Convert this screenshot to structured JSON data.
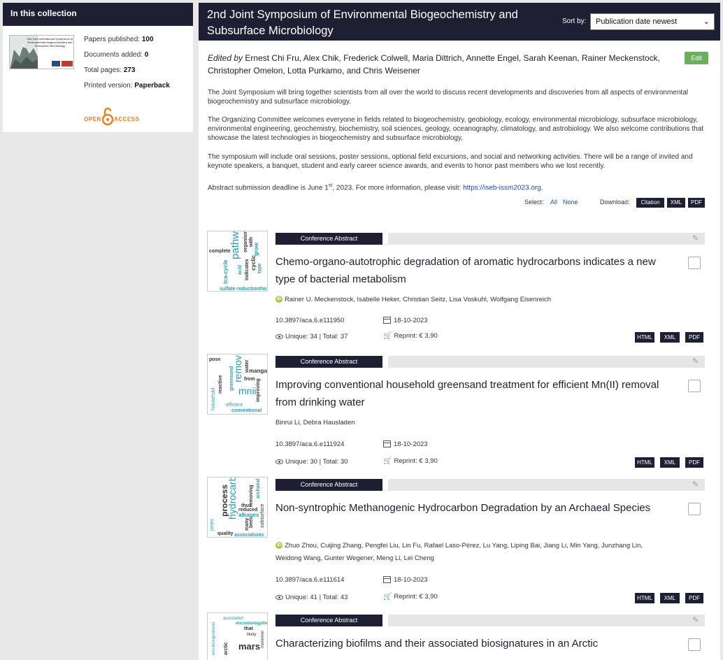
{
  "sidebar": {
    "heading": "In this collection",
    "cover_title": "2nd Joint International Symposium of Environmental Biogeochemistry and Subsurface Microbiology",
    "stats": [
      {
        "label": "Papers published:",
        "value": "100"
      },
      {
        "label": "Documents added:",
        "value": "0"
      },
      {
        "label": "Total pages:",
        "value": "273"
      },
      {
        "label": "Printed version:",
        "value": "Paperback"
      }
    ],
    "open_access": {
      "open": "OPEN",
      "access": "ACCESS"
    }
  },
  "header": {
    "title": "2nd Joint Symposium of Environmental Biogeochemistry and Subsurface Microbiology",
    "sort_label": "Sort by:",
    "sort_value": "Publication date newest"
  },
  "collection": {
    "edited_by": "Edited by",
    "editors": "Ernest Chi Fru, Alex Chik, Frederick Colwell, Maria Dittrich, Annette Engel, Sarah Keenan, Rainer Meckenstock, Christopher Omelon, Lotta Purkamo, and Chris Weisener",
    "edit_label": "Edit",
    "paragraphs": [
      "The Joint Symposium will bring together scientists from all over the world to discuss recent developments and discoveries from all aspects of environmental biogeochemistry and subsurface microbiology.",
      "The Organizing Committee welcomes everyone in fields related to biogeochemistry, geobiology, ecology, environmental microbiology, subsurface microbiology, environmental engineering, geochemistry, biochemistry, soil sciences, geology, oceanography, climatology, and astrobiology. We also welcome contributions that showcase the latest technologies in biogeochemistry and subsurface microbiology,",
      "The symposium will include oral sessions, poster sessions, optional field excursions, and social and networking activities. There will be a range of invited and keynote speakers, a banquet, student and early career science awards, and events to honor past members who we lost recently."
    ],
    "deadline_prefix": "Abstract submission deadline is June 1",
    "deadline_sup": "st",
    "deadline_suffix": ", 2023. For more information, please visit:",
    "deadline_link": "https://iseb-issm2023.org",
    "select_label": "Select:",
    "select_all": "All",
    "select_none": "None",
    "download_label": "Download:",
    "download_buttons": [
      "Citation",
      "XML",
      "PDF"
    ]
  },
  "articles": [
    {
      "type": "Conference Abstract",
      "title": "Chemo-organo-autotrophic degradation of aromatic hydrocarbons indicates a new type of bacterial metabolism",
      "authors": "Rainer U. Meckenstock, Isabelle Heker, Christian Seitz, Lisa Voskuhl, Wolfgang Eisenreich",
      "orcid": true,
      "doi": "10.3897/aca.6.e111950",
      "date": "18-10-2023",
      "views": "Unique: 34 | Total: 37",
      "reprint": "Reprint: € 3,90",
      "formats": [
        "HTML",
        "XML",
        "PDF"
      ]
    },
    {
      "type": "Conference Abstract",
      "title": "Improving conventional household greensand treatment for efficient Mn(II) removal from drinking water",
      "authors": "Binrui Li, Debra Hausladen",
      "orcid": false,
      "doi": "10.3897/aca.6.e111924",
      "date": "18-10-2023",
      "views": "Unique: 30 | Total: 30",
      "reprint": "Reprint: € 3,90",
      "formats": [
        "HTML",
        "XML",
        "PDF"
      ]
    },
    {
      "type": "Conference Abstract",
      "title": "Non-syntrophic Methanogenic Hydrocarbon Degradation by an Archaeal Species",
      "authors_line1": "Zhuo Zhou, Cuijing Zhang, Pengfei Liu, Lin Fu, Rafael Laso-Pérez, Lu Yang, Liping Bai, Jiang Li, Min Yang, Junzhang Lin,",
      "authors_line2": "Weidong Wang, Gunter Wegener, Meng Li, Lei Cheng",
      "orcid": true,
      "doi": "10.3897/aca.6.e111614",
      "date": "18-10-2023",
      "views": "Unique: 41 | Total: 43",
      "reprint": "Reprint: € 3,90",
      "formats": [
        "HTML",
        "XML",
        "PDF"
      ]
    },
    {
      "type": "Conference Abstract",
      "title": "Characterizing biofilms and their associated biosignatures in an Arctic"
    }
  ],
  "icons": {
    "pencil": "pencil-icon",
    "calendar": "calendar-icon",
    "eye": "eye-icon",
    "cart": "cart-icon",
    "orcid": "orcid-icon",
    "open-access": "open-access-lock-icon"
  },
  "colors": {
    "navy": "#1e1f33",
    "edit_green": "#6cae5b",
    "link_blue": "#1d4e9b",
    "oa_orange": "#f07d1c",
    "orcid_green": "#a6ce39"
  }
}
